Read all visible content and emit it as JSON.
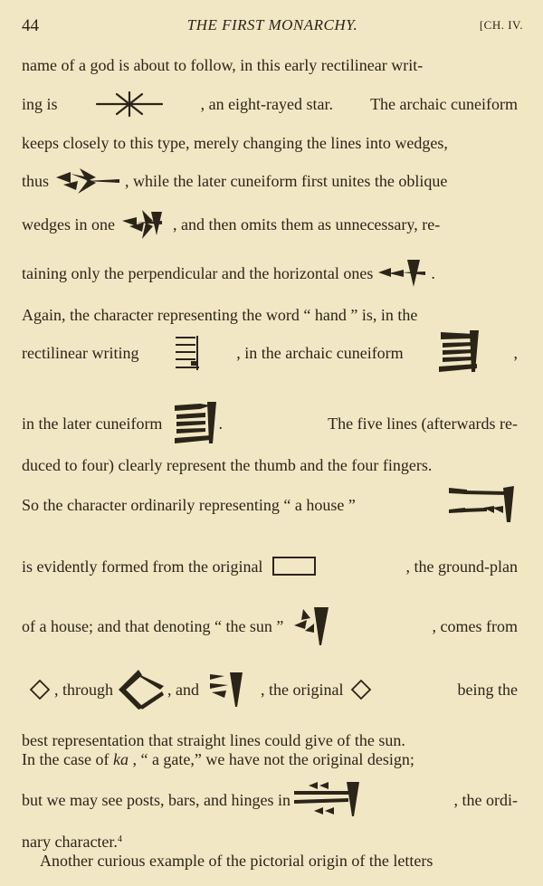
{
  "header": {
    "page_number": "44",
    "running_title": "THE FIRST MONARCHY.",
    "chapter": "[CH. IV."
  },
  "lines": {
    "l1": [
      "name of a god is about to follow, in this early rectilinear writ-"
    ],
    "l2": [
      "ing is",
      ", an eight-rayed star.",
      "The archaic cuneiform"
    ],
    "l3": [
      "keeps closely to this type, merely changing the lines into wedges,"
    ],
    "l4": [
      "thus",
      ", while the later cuneiform first unites the oblique"
    ],
    "l5": [
      "wedges in one",
      ", and then omits them as unnecessary, re-"
    ],
    "l6": [
      "taining only the perpendicular and the horizontal ones",
      "."
    ],
    "l7": [
      "Again, the character representing the word “ hand ” is, in the"
    ],
    "l8": [
      "rectilinear writing",
      ", in the archaic cuneiform",
      ","
    ],
    "l9": [
      "in the later cuneiform",
      ".",
      "The five lines (afterwards re-"
    ],
    "l10": [
      "duced to four) clearly represent the thumb and the four fingers."
    ],
    "l11": [
      "So the character ordinarily representing “ a house ”"
    ],
    "l12": [
      "is evidently formed from the original",
      ", the ground-plan"
    ],
    "l13": [
      "of a house; and that denoting “ the sun ”",
      ", comes from"
    ],
    "l14": [
      ", through",
      ", and",
      ", the original",
      "being the"
    ],
    "l15": [
      "best representation that straight lines could give of the sun."
    ],
    "l16a": [
      "In the case of"
    ],
    "l16b": [
      "ka"
    ],
    "l16c": [
      ", “ a gate,” we have not the original design;"
    ],
    "l17": [
      "but we may see posts, bars, and hinges in",
      ", the ordi-"
    ],
    "l18": [
      "nary character."
    ],
    "footnote_ref": "4",
    "l19": [
      "Another curious example of the pictorial origin of the letters"
    ]
  }
}
